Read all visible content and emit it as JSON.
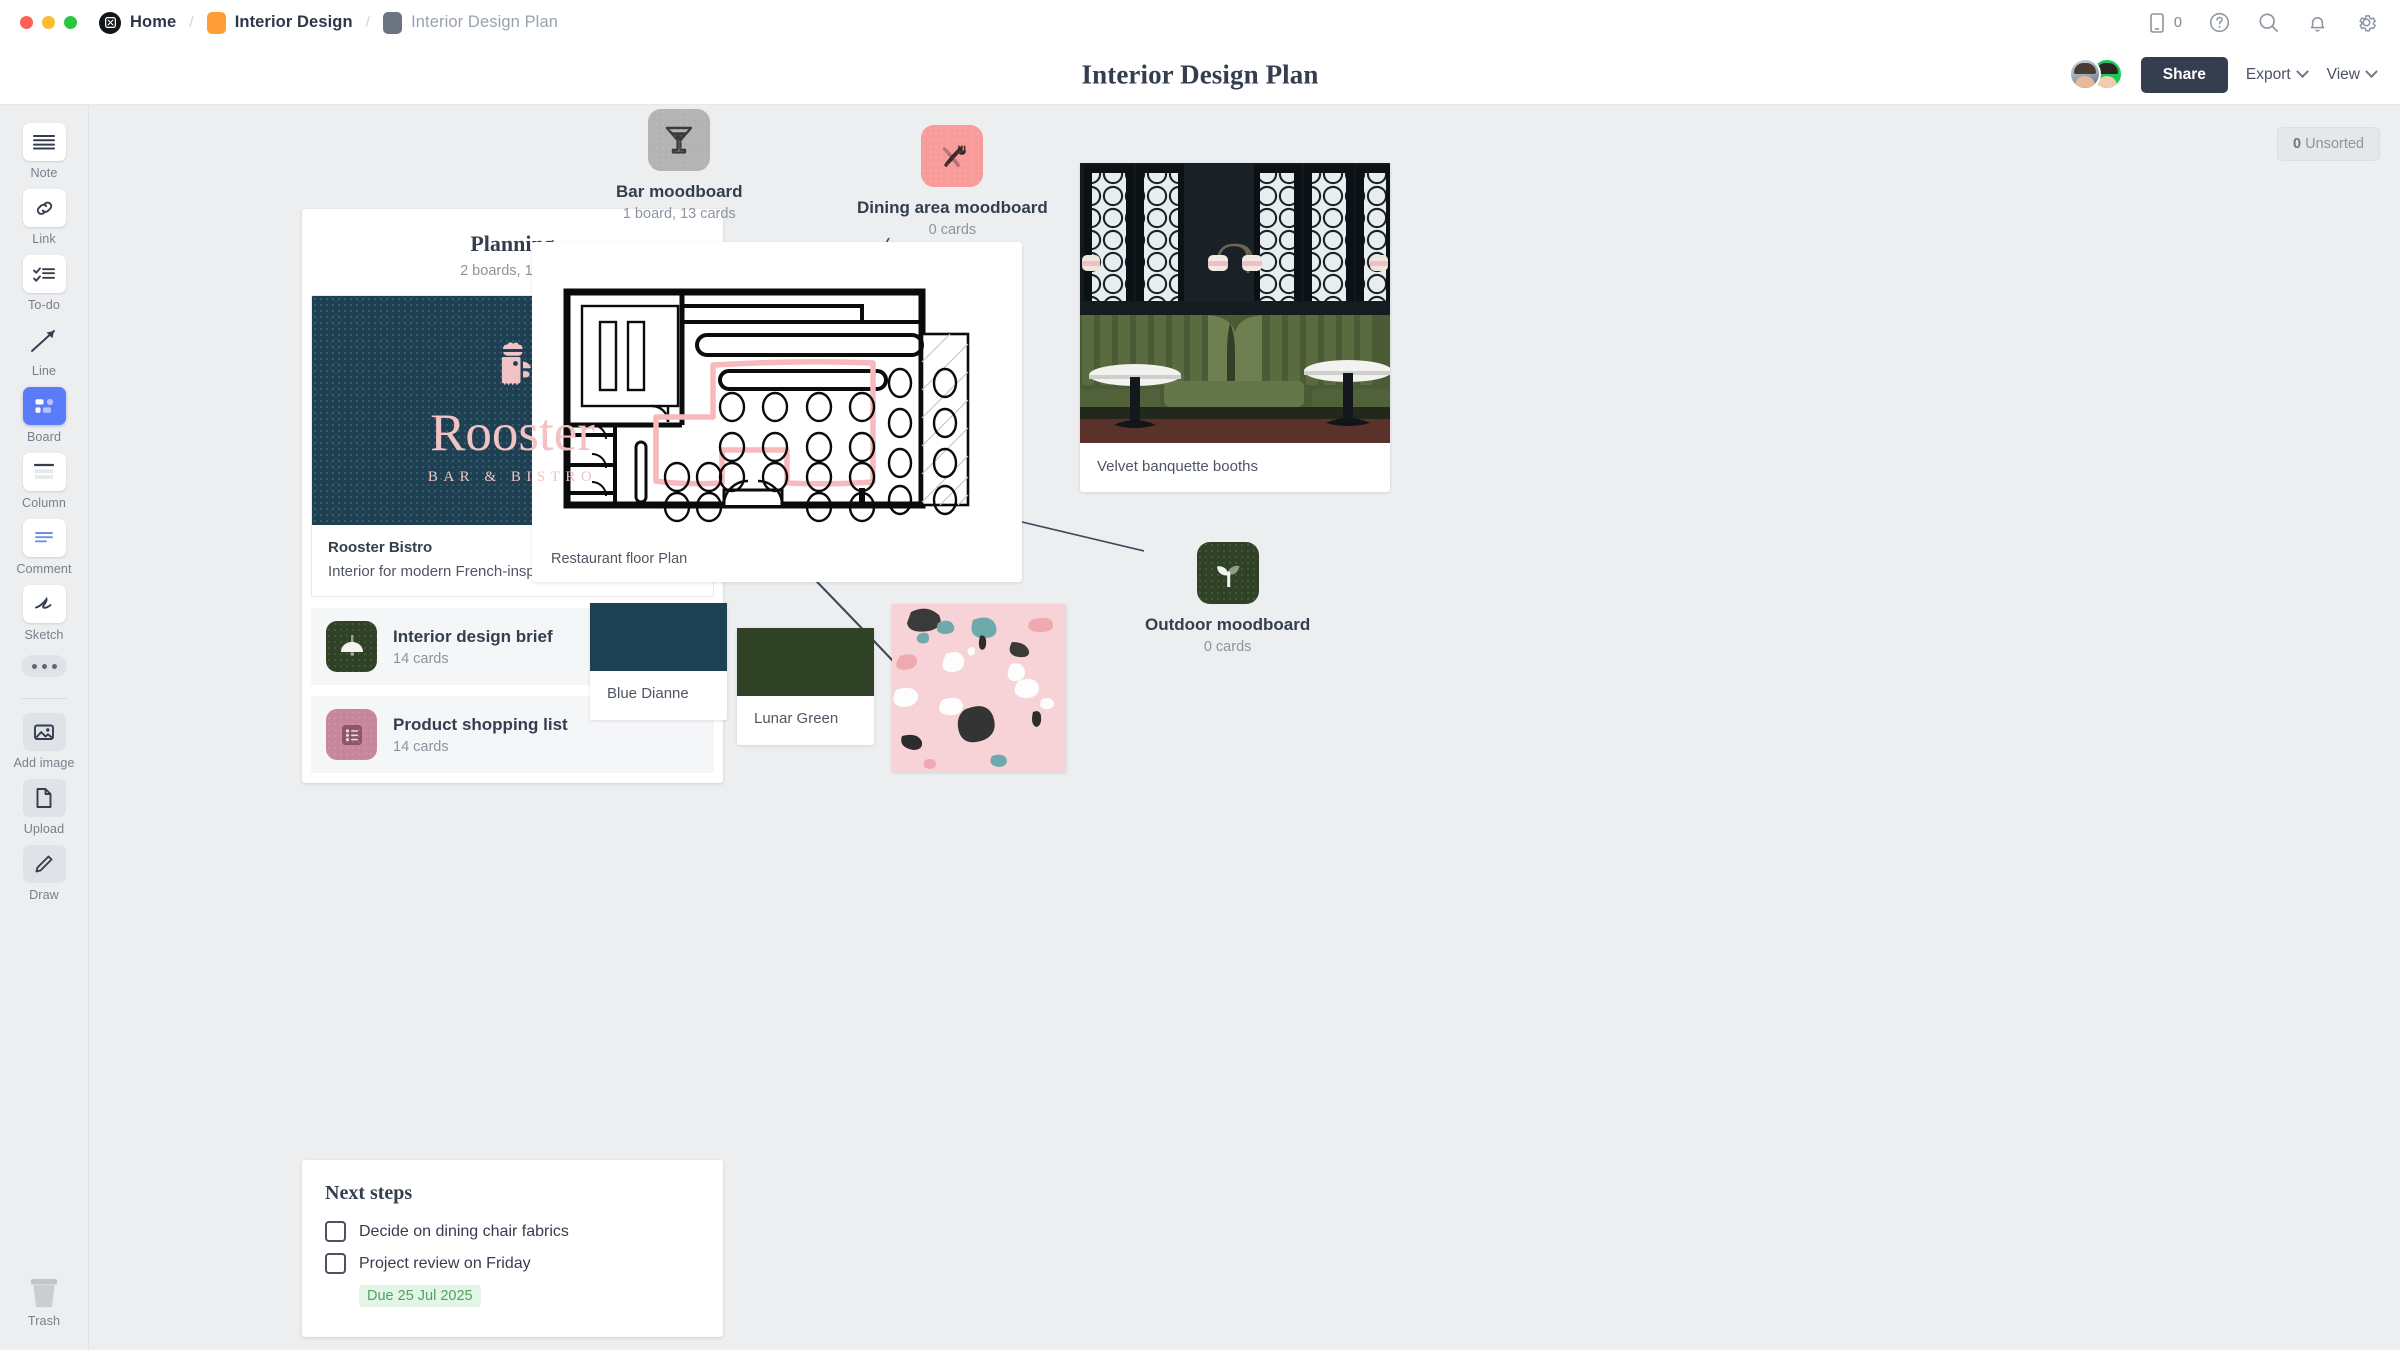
{
  "topbar": {
    "breadcrumbs": [
      {
        "label": "Home",
        "icon": "milanote-logo-icon",
        "muted": false
      },
      {
        "label": "Interior Design",
        "icon": "orange-board-icon",
        "muted": false
      },
      {
        "label": "Interior Design Plan",
        "icon": "grey-board-icon",
        "muted": true
      }
    ],
    "separator": "/",
    "mobile_count": "0",
    "icons": [
      "mobile-icon",
      "help-icon",
      "search-icon",
      "notifications-icon",
      "settings-icon"
    ]
  },
  "header": {
    "title": "Interior Design Plan",
    "share_label": "Share",
    "export_label": "Export",
    "view_label": "View"
  },
  "toolbar": {
    "items": [
      {
        "label": "Note",
        "icon": "note-icon"
      },
      {
        "label": "Link",
        "icon": "link-icon"
      },
      {
        "label": "To-do",
        "icon": "todo-icon"
      },
      {
        "label": "Line",
        "icon": "line-icon"
      },
      {
        "label": "Board",
        "icon": "board-icon"
      },
      {
        "label": "Column",
        "icon": "column-icon"
      },
      {
        "label": "Comment",
        "icon": "comment-icon"
      },
      {
        "label": "Sketch",
        "icon": "sketch-icon"
      },
      {
        "label": "",
        "icon": "more-dots-icon"
      }
    ],
    "items2": [
      {
        "label": "Add image",
        "icon": "add-image-icon"
      },
      {
        "label": "Upload",
        "icon": "upload-icon"
      },
      {
        "label": "Draw",
        "icon": "draw-icon"
      }
    ],
    "trash_label": "Trash"
  },
  "canvas": {
    "unsorted_count": "0",
    "unsorted_label": "Unsorted",
    "planning": {
      "title": "Planning",
      "subtitle": "2 boards, 1 card",
      "cover": {
        "brand": "Rooster",
        "tagline": "BAR & BISTRO",
        "bg": "#1d4053",
        "fg": "#f3c2c4"
      },
      "card_title": "Rooster Bistro",
      "card_desc": "Interior for modern French-inspired restaurant",
      "sub_boards": [
        {
          "title": "Interior design brief",
          "count": "14 cards",
          "icon": "pendant-lamp-icon",
          "color": "#2f4226"
        },
        {
          "title": "Product shopping list",
          "count": "14 cards",
          "icon": "list-icon",
          "color": "#c8869b"
        }
      ]
    },
    "next_steps": {
      "title": "Next steps",
      "todos": [
        {
          "label": "Decide on dining chair fabrics",
          "checked": false,
          "due": ""
        },
        {
          "label": "Project review on Friday",
          "checked": false,
          "due": "Due 25 Jul 2025"
        }
      ]
    },
    "floor_plan": {
      "caption": "Restaurant floor Plan"
    },
    "moodboards": [
      {
        "title": "Bar moodboard",
        "count": "1 board, 13 cards",
        "icon": "cocktail-icon",
        "color": "#b3b3b3"
      },
      {
        "title": "Dining area moodboard",
        "count": "0 cards",
        "icon": "cutlery-icon",
        "color": "#fa9b9b"
      },
      {
        "title": "Outdoor moodboard",
        "count": "0 cards",
        "icon": "seedling-icon",
        "color": "#2f4226"
      }
    ],
    "image_cards": [
      {
        "caption": "Velvet banquette booths",
        "image": "green-velvet-banquette-photo"
      }
    ],
    "swatches": [
      {
        "name": "Blue Dianne",
        "color": "#1d4053"
      },
      {
        "name": "Lunar Green",
        "color": "#2f4226"
      }
    ],
    "terrazzo": {
      "name": "pink-terrazzo-swatch",
      "base": "#f7d2d7"
    }
  }
}
